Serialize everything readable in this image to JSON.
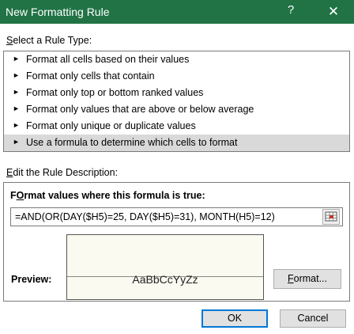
{
  "window": {
    "title": "New Formatting Rule",
    "help_label": "?",
    "close_label": "✕"
  },
  "rule_type": {
    "label_accel": "S",
    "label_rest": "elect a Rule Type:",
    "items": [
      {
        "label": "Format all cells based on their values",
        "selected": false
      },
      {
        "label": "Format only cells that contain",
        "selected": false
      },
      {
        "label": "Format only top or bottom ranked values",
        "selected": false
      },
      {
        "label": "Format only values that are above or below average",
        "selected": false
      },
      {
        "label": "Format only unique or duplicate values",
        "selected": false
      },
      {
        "label": "Use a formula to determine which cells to format",
        "selected": true
      }
    ],
    "arrow": "►"
  },
  "description": {
    "label_accel": "E",
    "label_rest": "dit the Rule Description:",
    "formula_heading_accel": "O",
    "formula_heading_rest_prefix": "F",
    "formula_heading_rest": "rmat values where this formula is true:",
    "formula_value": "=AND(OR(DAY($H5)=25, DAY($H5)=31), MONTH(H5)=12)",
    "preview_label": "Preview:",
    "preview_sample": "AaBbCcYyZz",
    "format_button_accel": "F",
    "format_button_rest": "ormat..."
  },
  "footer": {
    "ok_label": "OK",
    "cancel_label": "Cancel"
  },
  "colors": {
    "titlebar": "#217346",
    "selected_row": "#d9d9d9",
    "default_button_border": "#0078d7"
  }
}
